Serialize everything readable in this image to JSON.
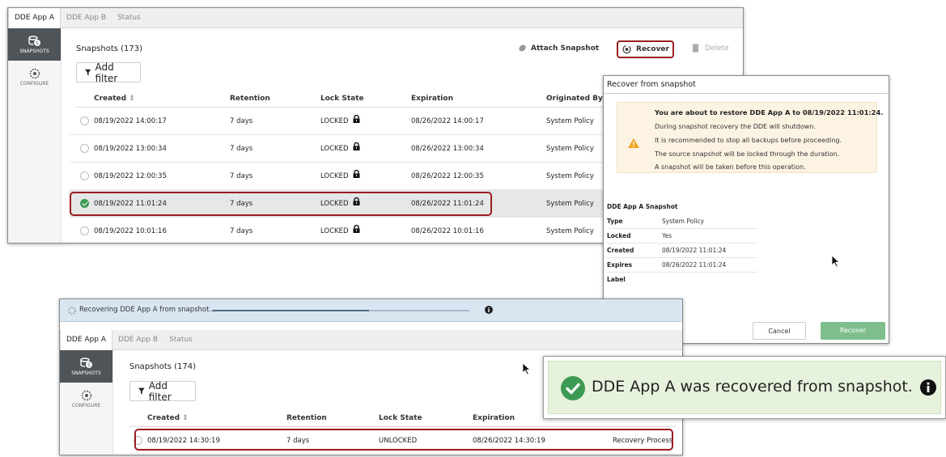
{
  "top_app": {
    "tabs": [
      "DDE App A",
      "DDE App B",
      "Status"
    ],
    "sidebar": {
      "snapshots": "SNAPSHOTS",
      "configure": "CONFIGURE"
    },
    "snapshots_title": "Snapshots (173)",
    "add_filter": "Add filter",
    "toolbar": {
      "attach": "Attach Snapshot",
      "recover": "Recover",
      "delete": "Delete"
    },
    "columns": [
      "Created",
      "Retention",
      "Lock State",
      "Expiration",
      "Originated By"
    ],
    "rows": [
      {
        "created": "08/19/2022 14:00:17",
        "retention": "7 days",
        "lock": "LOCKED",
        "expiration": "08/26/2022 14:00:17",
        "origin": "System Policy"
      },
      {
        "created": "08/19/2022 13:00:34",
        "retention": "7 days",
        "lock": "LOCKED",
        "expiration": "08/26/2022 13:00:34",
        "origin": "System Policy"
      },
      {
        "created": "08/19/2022 12:00:35",
        "retention": "7 days",
        "lock": "LOCKED",
        "expiration": "08/26/2022 12:00:35",
        "origin": "System Policy"
      },
      {
        "created": "08/19/2022 11:01:24",
        "retention": "7 days",
        "lock": "LOCKED",
        "expiration": "08/26/2022 11:01:24",
        "origin": "System Policy",
        "selected": true
      },
      {
        "created": "08/19/2022 10:01:16",
        "retention": "7 days",
        "lock": "LOCKED",
        "expiration": "08/26/2022 10:01:16",
        "origin": "System Policy"
      }
    ]
  },
  "dialog": {
    "title": "Recover from snapshot",
    "warning": [
      "You are about to restore DDE App A to 08/19/2022 11:01:24.",
      "During snapshot recovery the DDE will shutdown.",
      "It is recommended to stop all backups before proceeding.",
      "The source snapshot will be locked through the duration.",
      "A snapshot will be taken before this operation."
    ],
    "section_title": "DDE App A Snapshot",
    "fields": [
      {
        "key": "Type",
        "value": "System Policy"
      },
      {
        "key": "Locked",
        "value": "Yes"
      },
      {
        "key": "Created",
        "value": "08/19/2022 11:01:24"
      },
      {
        "key": "Expires",
        "value": "08/26/2022 11:01:24"
      },
      {
        "key": "Label",
        "value": ""
      }
    ],
    "cancel": "Cancel",
    "recover": "Recover"
  },
  "bottom_app": {
    "progress_text": "Recovering DDE App A from snapshot.",
    "progress_fraction": 0.61,
    "tabs": [
      "DDE App A",
      "DDE App B",
      "Status"
    ],
    "sidebar": {
      "snapshots": "SNAPSHOTS",
      "configure": "CONFIGURE"
    },
    "snapshots_title": "Snapshots (174)",
    "add_filter": "Add filter",
    "columns": [
      "Created",
      "Retention",
      "Lock State",
      "Expiration"
    ],
    "row": {
      "created": "08/19/2022 14:30:19",
      "retention": "7 days",
      "lock": "UNLOCKED",
      "expiration": "08/26/2022 14:30:19",
      "origin": "Recovery Process"
    }
  },
  "toast": {
    "text": "DDE App A was recovered from snapshot."
  },
  "colors": {
    "accent_red": "#9b1d21",
    "success_green": "#3d9a53",
    "recover_button": "#7fbf8e",
    "toast_bg": "#e6f2dc"
  }
}
